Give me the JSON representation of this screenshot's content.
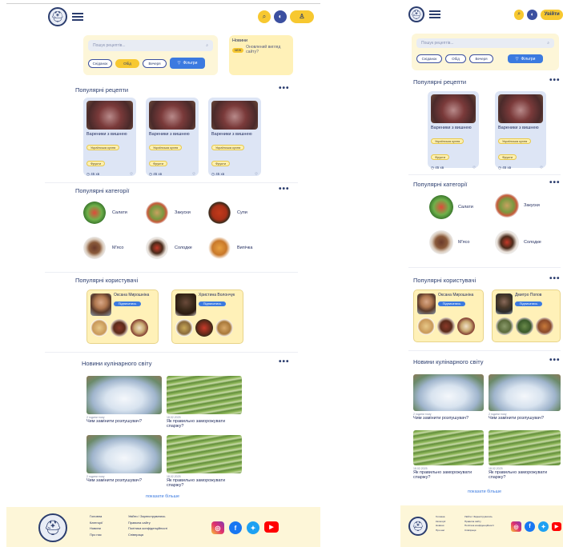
{
  "header": {
    "menu_icon": "hamburger-icon",
    "logo_icon": "pot-logo-icon",
    "search_button_icon": "search-icon",
    "theme_button_icon": "theme-icon",
    "profile_icon": "user-icon",
    "login_label": "Увійти"
  },
  "search": {
    "placeholder": "Пошук рецептів...",
    "meal_filters": [
      "Сніданок",
      "Обід",
      "Вечеря"
    ],
    "active_filter": "Обід",
    "filters_label": "Фільтри"
  },
  "news_box": {
    "title": "Новини",
    "badge": "NEW",
    "text": "Оновлений вигляд сайту?"
  },
  "popular_recipes": {
    "title": "Популярні рецепти",
    "more": "•••",
    "cards": [
      {
        "title": "Вареники з вишнею",
        "tags": [
          "Українська кухня",
          "Фрукти"
        ],
        "time": "45 хв"
      },
      {
        "title": "Вареники з вишнею",
        "tags": [
          "Українська кухня",
          "Фрукти"
        ],
        "time": "45 хв"
      },
      {
        "title": "Вареники з вишнею",
        "tags": [
          "Українська кухня",
          "Фрукти"
        ],
        "time": "45 хв"
      }
    ]
  },
  "popular_categories": {
    "title": "Популярні категорії",
    "more": "•••",
    "items": [
      "Салати",
      "Закуски",
      "Супи",
      "М'ясо",
      "Солодке",
      "Випічка"
    ]
  },
  "popular_users": {
    "title": "Популярні користувачі",
    "subscribe_label": "Підписатись",
    "users": [
      {
        "name": "Оксана Мирошніченко",
        "short_name": "Оксана Мирошніна"
      },
      {
        "name": "Христина Волончук",
        "short_name": "Христина Волончук"
      },
      {
        "name": "Дмитро Попов",
        "short_name": "Дмитро Попов"
      }
    ]
  },
  "news": {
    "title": "Новини кулінарного світу",
    "more": "•••",
    "items": [
      {
        "date": "2 години тому",
        "title": "Чим замінити розпушувач?"
      },
      {
        "date": "18.02.2025",
        "title": "Як правильно заморожувати спаржу?"
      },
      {
        "date": "2 години тому",
        "title": "Чим замінити розпушувач?"
      },
      {
        "date": "18.02.2025",
        "title": "Як правильно заморожувати спаржу?"
      }
    ],
    "show_more": "показати більше"
  },
  "footer": {
    "col1": [
      "Головна",
      "Категорії",
      "Новини",
      "Про нас"
    ],
    "col2": [
      "Увійти / Зареєструватись",
      "Правила сайту",
      "Політика конфіденційності",
      "Співпраця"
    ],
    "social": [
      "instagram-icon",
      "facebook-icon",
      "twitter-icon",
      "youtube-icon"
    ]
  },
  "colors": {
    "navy": "#2b3d6e",
    "yellow": "#f7c830",
    "blue_accent": "#3b7ae0",
    "card_bg": "#dde5f5",
    "cream": "#fdf6d8"
  }
}
